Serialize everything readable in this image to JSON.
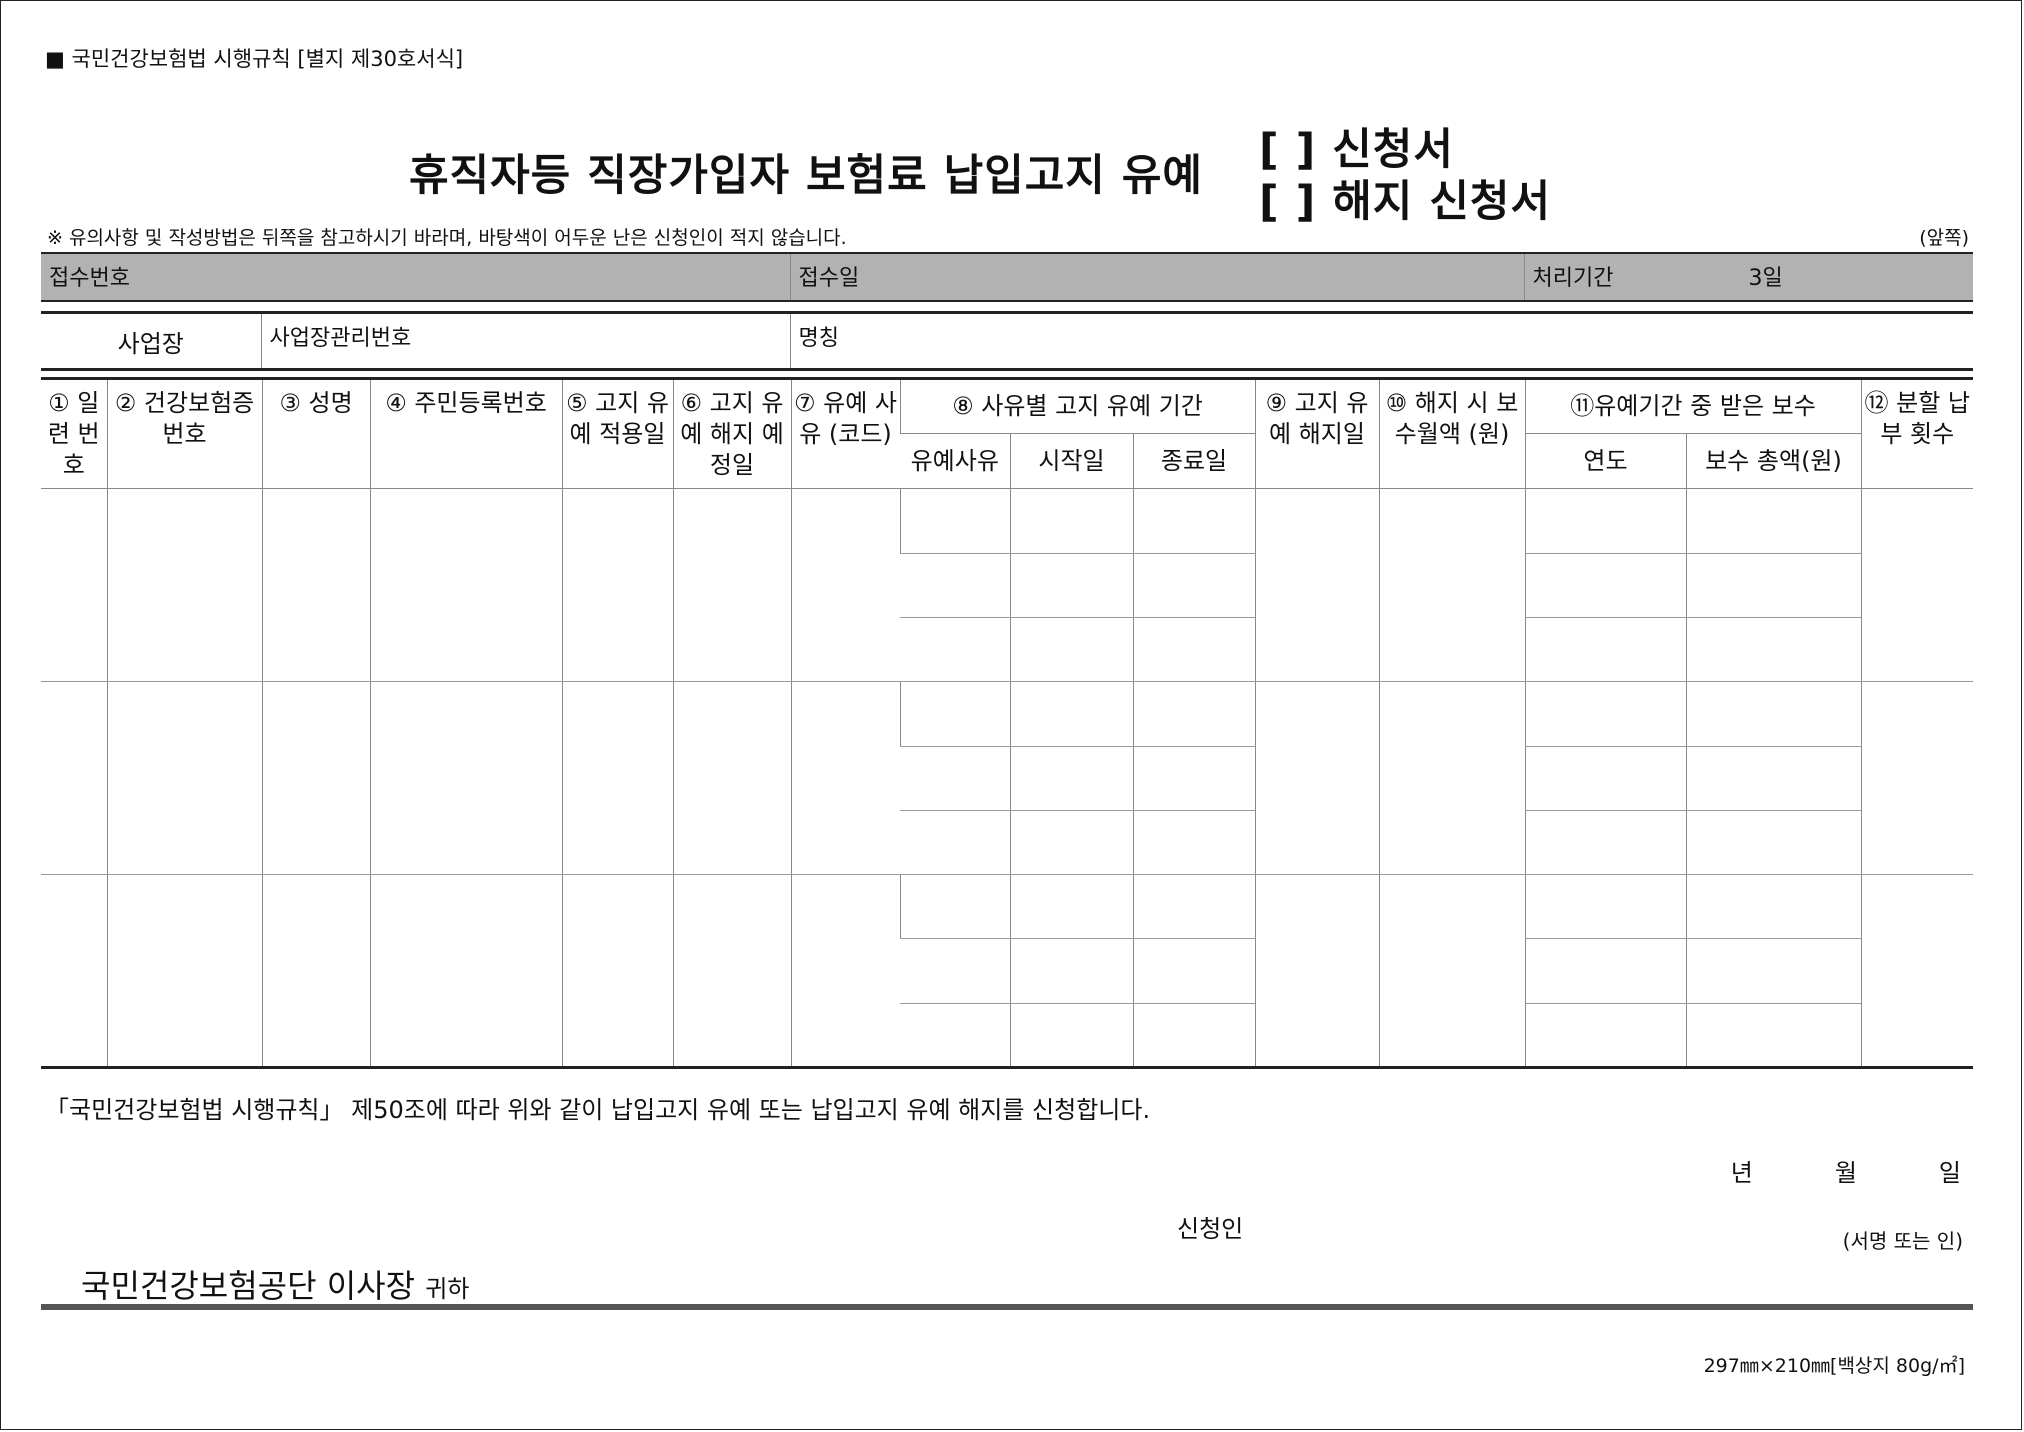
{
  "form": {
    "legal_ref": "■ 국민건강보험법 시행규칙 [별지 제30호서식]",
    "title": "휴직자등 직장가입자 보험료 납입고지 유예",
    "option_apply": "[   ] 신청서",
    "option_cancel": "[   ] 해지 신청서",
    "note": "※ 유의사항 및 작성방법은 뒤쪽을 참고하시기 바라며, 바탕색이 어두운 난은 신청인이 적지 않습니다.",
    "page_side": "(앞쪽)"
  },
  "receipt": {
    "number_label": "접수번호",
    "date_label": "접수일",
    "period_label": "처리기간",
    "period_value": "3일"
  },
  "business": {
    "label": "사업장",
    "id_label": "사업장관리번호",
    "name_label": "명칭"
  },
  "columns": {
    "c1": "① 일련 번호",
    "c2": "② 건강보험증 번호",
    "c3": "③ 성명",
    "c4": "④ 주민등록번호",
    "c5": "⑤ 고지 유예 적용일",
    "c6": "⑥ 고지 유예 해지 예정일",
    "c7": "⑦ 유예 사유 (코드)",
    "c8": "⑧ 사유별 고지 유예 기간",
    "c8a": "유예사유",
    "c8b": "시작일",
    "c8c": "종료일",
    "c9": "⑨ 고지 유예 해지일",
    "c10": "⑩ 해지 시 보수월액 (원)",
    "c11": "⑪유예기간 중 받은 보수",
    "c11a": "연도",
    "c11b": "보수 총액(원)",
    "c12": "⑫ 분할 납부 횟수"
  },
  "declaration": "「국민건강보험법 시행규칙」 제50조에 따라 위와 같이 납입고지 유예 또는 납입고지 유예 해지를 신청합니다.",
  "date": {
    "year": "년",
    "month": "월",
    "day": "일"
  },
  "applicant_label": "신청인",
  "sign_label": "(서명 또는 인)",
  "addressee": "국민건강보험공단 이사장",
  "addressee_suffix": "귀하",
  "paper_spec": "297㎜×210㎜[백상지 80g/㎡]"
}
